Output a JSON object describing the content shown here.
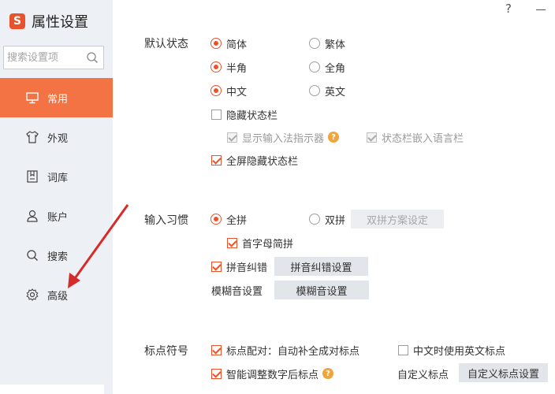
{
  "app": {
    "logo": "S",
    "title": "属性设置"
  },
  "window": {
    "help": "?"
  },
  "search": {
    "placeholder": "搜索设置项"
  },
  "sidebar": {
    "items": [
      {
        "label": "常用",
        "icon": "monitor-icon",
        "active": true
      },
      {
        "label": "外观",
        "icon": "shirt-icon"
      },
      {
        "label": "词库",
        "icon": "book-icon"
      },
      {
        "label": "账户",
        "icon": "user-icon"
      },
      {
        "label": "搜索",
        "icon": "search-icon"
      },
      {
        "label": "高级",
        "icon": "gear-icon"
      }
    ]
  },
  "default_state": {
    "title": "默认状态",
    "simplified": "简体",
    "traditional": "繁体",
    "half_width": "半角",
    "full_width": "全角",
    "chinese": "中文",
    "english": "英文",
    "hide_status_bar": "隐藏状态栏",
    "show_indicator": "显示输入法指示器",
    "embed_language_bar": "状态栏嵌入语言栏",
    "fullscreen_hide": "全屏隐藏状态栏"
  },
  "input_habit": {
    "title": "输入习惯",
    "quanpin": "全拼",
    "shuangpin": "双拼",
    "shuangpin_btn": "双拼方案设定",
    "initial_jianpin": "首字母简拼",
    "correction": "拼音纠错",
    "correction_btn": "拼音纠错设置",
    "fuzzy_label": "模糊音设置",
    "fuzzy_btn": "模糊音设置"
  },
  "punctuation": {
    "title": "标点符号",
    "pairing": "标点配对：自动补全成对标点",
    "english_punct": "中文时使用英文标点",
    "smart_adjust": "智能调整数字后标点",
    "custom_label": "自定义标点",
    "custom_btn": "自定义标点设置"
  },
  "colors": {
    "accent": "#f47344",
    "check": "#e8532d",
    "sidebar_bg": "#edf0f5"
  }
}
